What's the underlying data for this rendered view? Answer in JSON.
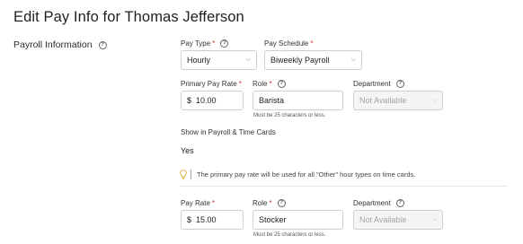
{
  "page": {
    "title": "Edit Pay Info for Thomas Jefferson",
    "section_label": "Payroll Information"
  },
  "labels": {
    "pay_type": "Pay Type",
    "pay_schedule": "Pay Schedule",
    "primary_pay_rate": "Primary Pay Rate",
    "role": "Role",
    "department": "Department",
    "pay_rate": "Pay Rate",
    "required_mark": "*",
    "help_glyph": "?"
  },
  "fields": {
    "pay_type_value": "Hourly",
    "pay_schedule_value": "Biweekly Payroll",
    "currency_symbol": "$",
    "primary_pay_rate_value": "10.00",
    "role_1_value": "Barista",
    "role_hint": "Must be 25 characters or less.",
    "department_placeholder": "Not Available",
    "pay_rate_2_value": "15.00",
    "role_2_value": "Stocker"
  },
  "show_in_payroll": {
    "label": "Show in Payroll & Time Cards",
    "value": "Yes"
  },
  "info_note": "The primary pay rate will be used for all \"Other\" hour types on time cards.",
  "icons": {
    "help": "question-circle-icon",
    "dropdown": "chevron-down-icon",
    "info": "lightbulb-icon"
  },
  "colors": {
    "required": "#d0312d",
    "bulb": "#e0b13a"
  }
}
